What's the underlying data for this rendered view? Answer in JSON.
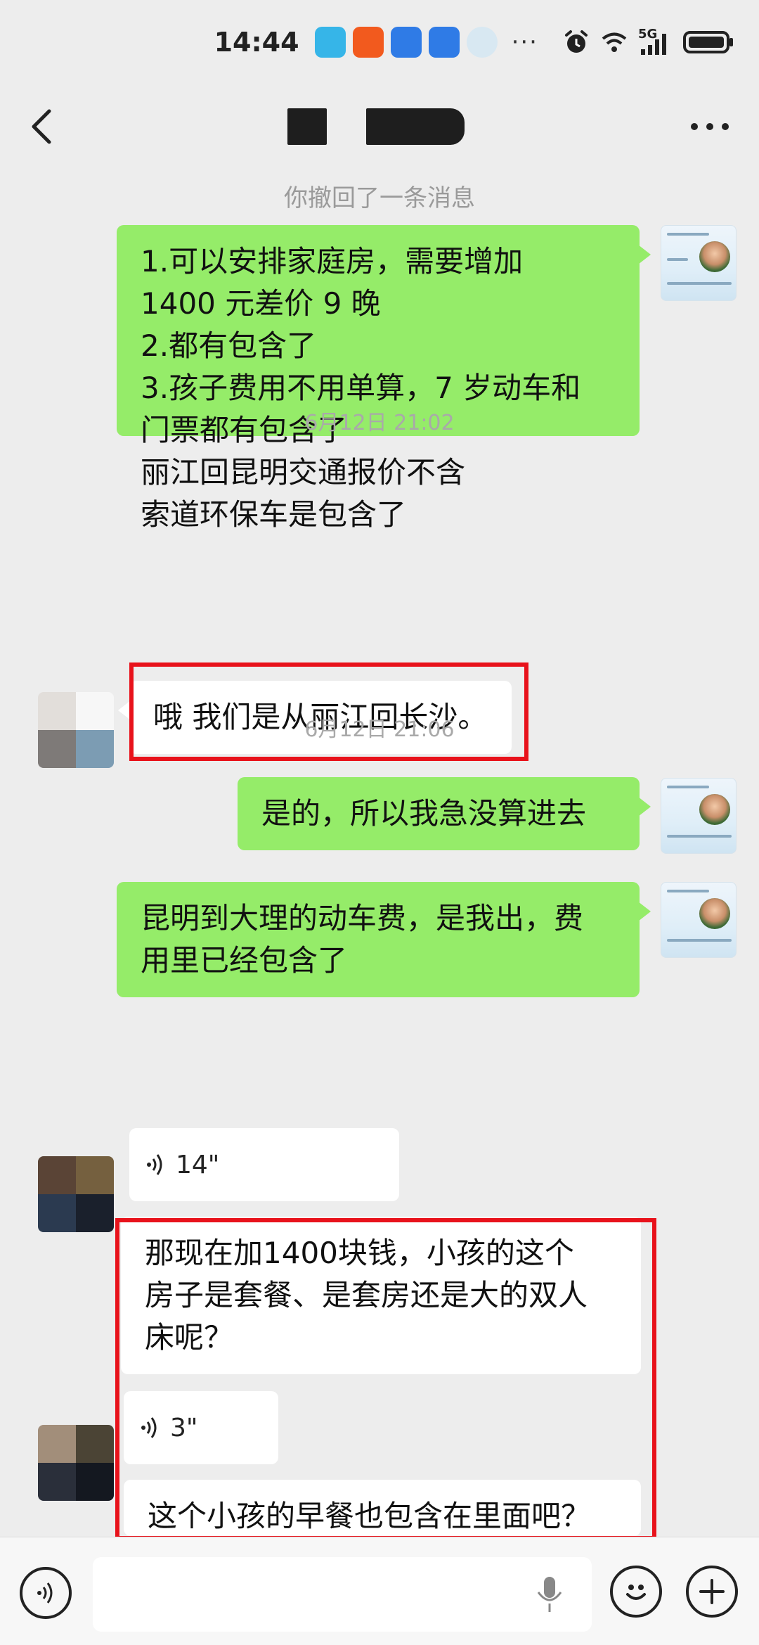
{
  "status_bar": {
    "time": "14:44",
    "more_indicator": "···",
    "network_label": "5G",
    "signal_sup": "6"
  },
  "header": {
    "back_icon": "chevron-left-icon",
    "more_icon": "more-horizontal-icon"
  },
  "chat": {
    "recall_notice": "你撤回了一条消息",
    "messages": [
      {
        "side": "right",
        "lines": [
          "1.可以安排家庭房，需要增加",
          "1400 元差价 9 晚",
          "2.都有包含了",
          "3.孩子费用不用单算，7 岁动车和",
          "门票都有包含了",
          "丽江回昆明交通报价不含",
          "索道环保车是包含了"
        ]
      },
      {
        "timestamp": "6月12日 21:02"
      },
      {
        "side": "left",
        "text": "哦 我们是从丽江回长沙。"
      },
      {
        "side": "right",
        "text": "是的，所以我急没算进去"
      },
      {
        "side": "right",
        "lines": [
          "昆明到大理的动车费，是我出，费",
          "用里已经包含了"
        ]
      },
      {
        "timestamp": "6月12日 21:06"
      },
      {
        "side": "left",
        "type": "voice",
        "duration": "14\""
      },
      {
        "side": "left",
        "lines": [
          "那现在加1400块钱，小孩的这个",
          "房子是套餐、是套房还是大的双人",
          "床呢？"
        ]
      },
      {
        "side": "left",
        "type": "voice",
        "duration": "3\""
      },
      {
        "side": "left",
        "text": "这个小孩的早餐也包含在里面吧？"
      }
    ]
  },
  "input_bar": {
    "voice_icon": "voice-mode-icon",
    "mic_icon": "microphone-icon",
    "emoji_icon": "emoji-icon",
    "add_icon": "plus-icon"
  },
  "colors": {
    "background": "#ededed",
    "sent_bubble": "#95ec69",
    "received_bubble": "#ffffff",
    "highlight_box": "#e8121b"
  }
}
